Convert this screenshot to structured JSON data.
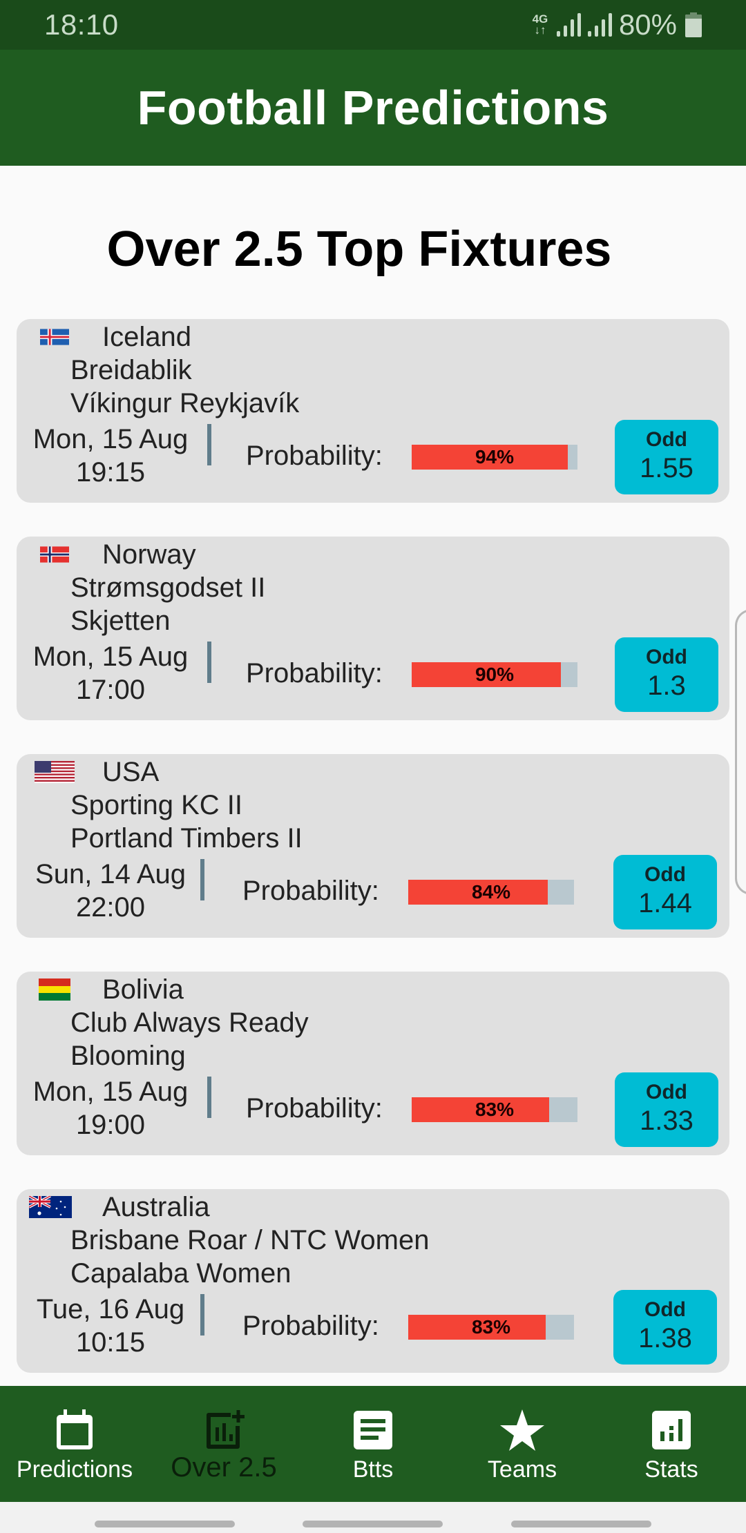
{
  "status_bar": {
    "time": "18:10",
    "network": "4G",
    "battery_percent": "80%"
  },
  "app_bar": {
    "title": "Football Predictions"
  },
  "page": {
    "heading": "Over 2.5 Top Fixtures"
  },
  "labels": {
    "probability": "Probability:",
    "odd": "Odd"
  },
  "fixtures": [
    {
      "country": "Iceland",
      "flag": "iceland-flag",
      "home": "Breidablik",
      "away": "Víkingur Reykjavík",
      "date": "Mon, 15 Aug",
      "time": "19:15",
      "probability": 94,
      "probability_text": "94%",
      "odd": "1.55"
    },
    {
      "country": "Norway",
      "flag": "norway-flag",
      "home": "Strømsgodset II",
      "away": "Skjetten",
      "date": "Mon, 15 Aug",
      "time": "17:00",
      "probability": 90,
      "probability_text": "90%",
      "odd": "1.3"
    },
    {
      "country": "USA",
      "flag": "usa-flag",
      "home": "Sporting KC II",
      "away": "Portland Timbers II",
      "date": "Sun, 14 Aug",
      "time": "22:00",
      "probability": 84,
      "probability_text": "84%",
      "odd": "1.44"
    },
    {
      "country": "Bolivia",
      "flag": "bolivia-flag",
      "home": "Club Always Ready",
      "away": "Blooming",
      "date": "Mon, 15 Aug",
      "time": "19:00",
      "probability": 83,
      "probability_text": "83%",
      "odd": "1.33"
    },
    {
      "country": "Australia",
      "flag": "australia-flag",
      "home": "Brisbane Roar / NTC Women",
      "away": "Capalaba Women",
      "date": "Tue, 16 Aug",
      "time": "10:15",
      "probability": 83,
      "probability_text": "83%",
      "odd": "1.38"
    }
  ],
  "bottom_nav": [
    {
      "label": "Predictions",
      "icon": "calendar-icon",
      "active": false
    },
    {
      "label": "Over 2.5",
      "icon": "chart-add-icon",
      "active": true
    },
    {
      "label": "Btts",
      "icon": "list-icon",
      "active": false
    },
    {
      "label": "Teams",
      "icon": "star-icon",
      "active": false
    },
    {
      "label": "Stats",
      "icon": "bar-chart-icon",
      "active": false
    }
  ],
  "colors": {
    "primary": "#1f5c20",
    "status_bar": "#1a4b1a",
    "card_bg": "#e0e0e0",
    "probability_fill": "#f44336",
    "probability_track": "#b9c8cf",
    "odd_box": "#00bcd4",
    "divider": "#607d8b"
  }
}
